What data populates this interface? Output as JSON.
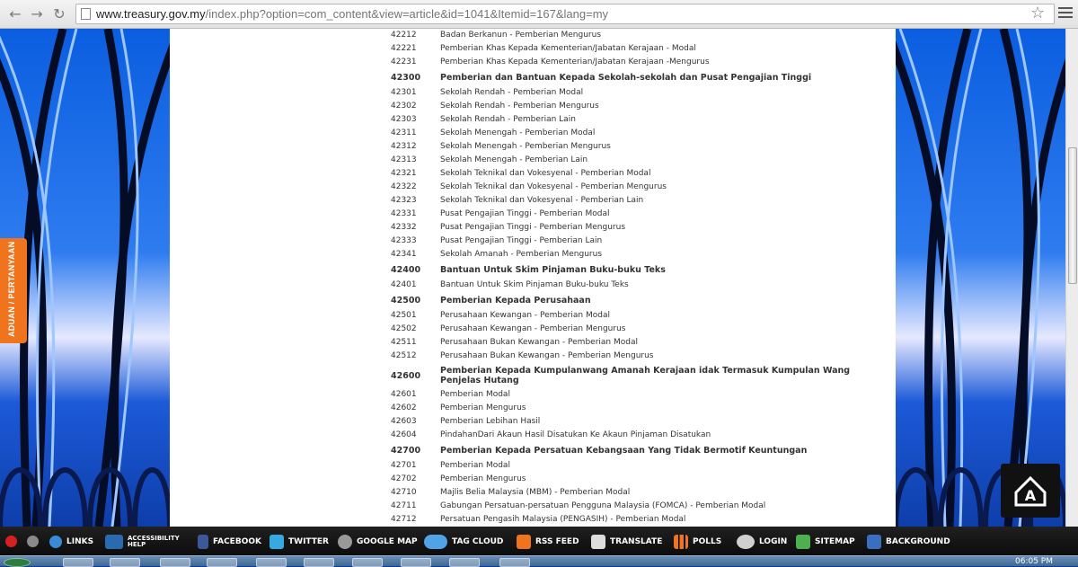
{
  "browser": {
    "url_host": "www.treasury.gov.my",
    "url_path": "/index.php?option=com_content&view=article&id=1041&Itemid=167&lang=my",
    "back_icon": "back-arrow-icon",
    "forward_icon": "forward-arrow-icon",
    "reload_icon": "reload-icon"
  },
  "side_tab": {
    "label": "ADUAN / PERTANYAAN"
  },
  "rows": [
    {
      "code": "42212",
      "desc": "Badan Berkanun - Pemberian Mengurus"
    },
    {
      "code": "42221",
      "desc": "Pemberian Khas Kepada Kementerian/Jabatan Kerajaan - Modal"
    },
    {
      "code": "42231",
      "desc": "Pemberian Khas Kepada Kementerian/Jabatan Kerajaan -Mengurus"
    },
    {
      "code": "42300",
      "desc": "Pemberian dan Bantuan Kepada Sekolah-sekolah dan Pusat Pengajian Tinggi",
      "head": true
    },
    {
      "code": "42301",
      "desc": "Sekolah Rendah - Pemberian Modal"
    },
    {
      "code": "42302",
      "desc": "Sekolah Rendah - Pemberian Mengurus"
    },
    {
      "code": "42303",
      "desc": "Sekolah Rendah - Pemberian Lain"
    },
    {
      "code": "42311",
      "desc": "Sekolah Menengah - Pemberian Modal"
    },
    {
      "code": "42312",
      "desc": "Sekolah Menengah - Pemberian Mengurus"
    },
    {
      "code": "42313",
      "desc": "Sekolah Menengah - Pemberian Lain"
    },
    {
      "code": "42321",
      "desc": "Sekolah Teknikal dan Vokesyenal - Pemberian Modal"
    },
    {
      "code": "42322",
      "desc": "Sekolah Teknikal dan Vokesyenal - Pemberian Mengurus"
    },
    {
      "code": "42323",
      "desc": "Sekolah Teknikal dan Vokesyenal - Pemberian Lain"
    },
    {
      "code": "42331",
      "desc": "Pusat Pengajian Tinggi - Pemberian Modal"
    },
    {
      "code": "42332",
      "desc": "Pusat Pengajian Tinggi - Pemberian Mengurus"
    },
    {
      "code": "42333",
      "desc": "Pusat Pengajian Tinggi - Pemberian Lain"
    },
    {
      "code": "42341",
      "desc": "Sekolah Amanah - Pemberian Mengurus"
    },
    {
      "code": "42400",
      "desc": "Bantuan Untuk Skim Pinjaman Buku-buku Teks",
      "head": true
    },
    {
      "code": "42401",
      "desc": "Bantuan Untuk Skim Pinjaman Buku-buku Teks"
    },
    {
      "code": "42500",
      "desc": "Pemberian Kepada Perusahaan",
      "head": true
    },
    {
      "code": "42501",
      "desc": "Perusahaan Kewangan - Pemberian Modal"
    },
    {
      "code": "42502",
      "desc": "Perusahaan Kewangan - Pemberian Mengurus"
    },
    {
      "code": "42511",
      "desc": "Perusahaan Bukan Kewangan - Pemberian Modal"
    },
    {
      "code": "42512",
      "desc": "Perusahaan Bukan Kewangan - Pemberian Mengurus"
    },
    {
      "code": "42600",
      "desc": "Pemberian Kepada Kumpulanwang Amanah Kerajaan idak Termasuk Kumpulan Wang Penjelas Hutang",
      "head": true,
      "two": true
    },
    {
      "code": "42601",
      "desc": "Pemberian Modal"
    },
    {
      "code": "42602",
      "desc": "Pemberian Mengurus"
    },
    {
      "code": "42603",
      "desc": "Pemberian Lebihan Hasil"
    },
    {
      "code": "42604",
      "desc": "PindahanDari Akaun Hasil Disatukan Ke Akaun Pinjaman Disatukan"
    },
    {
      "code": "42700",
      "desc": "Pemberian Kepada Persatuan Kebangsaan Yang Tidak Bermotif Keuntungan",
      "head": true
    },
    {
      "code": "42701",
      "desc": "Pemberian Modal"
    },
    {
      "code": "42702",
      "desc": "Pemberian Mengurus"
    },
    {
      "code": "42710",
      "desc": "Majlis Belia Malaysia (MBM) - Pemberian Modal"
    },
    {
      "code": "42711",
      "desc": "Gabungan Persatuan-persatuan Pengguna Malaysia (FOMCA) - Pemberian Modal"
    },
    {
      "code": "42712",
      "desc": "Persatuan Pengasih Malaysia (PENGASIH) - Pemberian Modal"
    }
  ],
  "toolbar": {
    "links": "LINKS",
    "accessibility": "ACCESSIBILITY HELP",
    "facebook": "FACEBOOK",
    "twitter": "TWITTER",
    "google_map": "GOOGLE MAP",
    "tag_cloud": "TAG CLOUD",
    "rss_feed": "RSS FEED",
    "translate": "TRANSLATE",
    "polls": "POLLS",
    "login": "LOGIN",
    "sitemap": "SITEMAP",
    "background": "BACKGROUND",
    "colors": {
      "close": "#d52020",
      "help": "#8a8a8a",
      "facebook": "#3b5998",
      "twitter": "#35a9e0",
      "accent": "#f0741e"
    }
  },
  "taskbar": {
    "clock": "06:05 PM"
  }
}
